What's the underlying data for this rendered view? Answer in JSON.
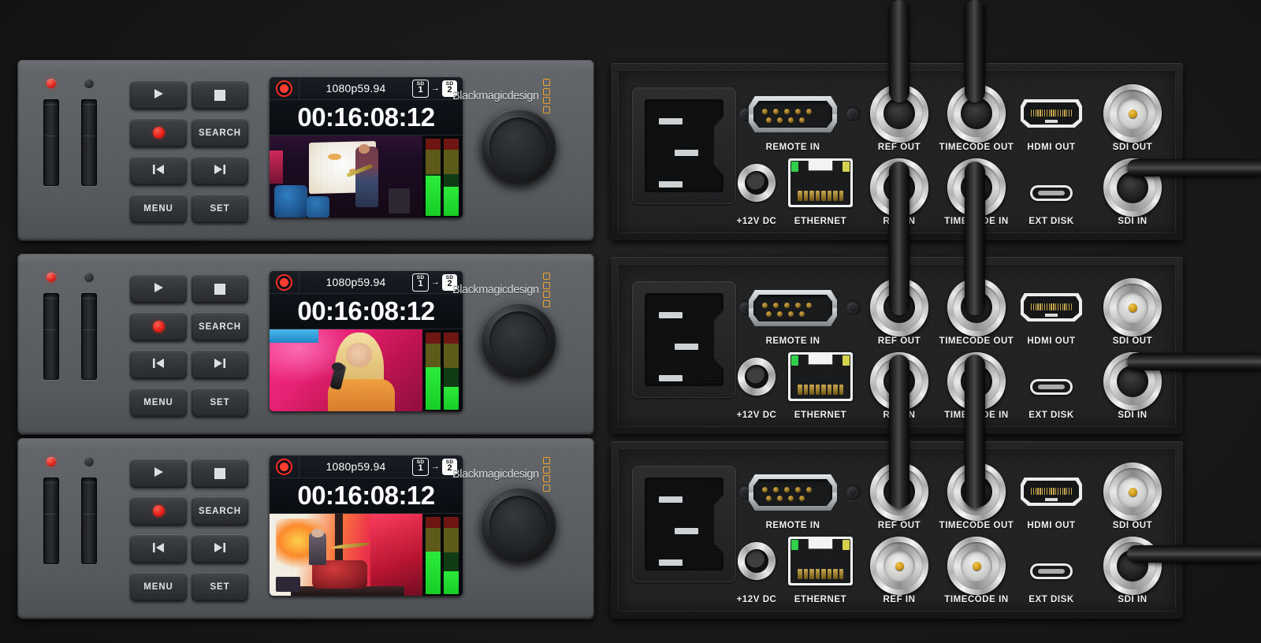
{
  "scene": {
    "description": "Three rack-mounted Blackmagic Design HyperDeck broadcast recorders, front panels left and rear panels right",
    "background_color": "#141414"
  },
  "brand": {
    "name": "Blackmagicdesign",
    "logo_color": "#f0a32a",
    "logo_square_count": 4
  },
  "front_panel": {
    "leds": [
      {
        "name": "power-led",
        "state": "on",
        "color": "#e3231d"
      },
      {
        "name": "status-led",
        "state": "off",
        "color": "#2a2c2f"
      }
    ],
    "card_slots": [
      "slot-1",
      "slot-2"
    ],
    "buttons": [
      {
        "id": "play",
        "label": "",
        "icon": "play-icon"
      },
      {
        "id": "stop",
        "label": "",
        "icon": "stop-icon"
      },
      {
        "id": "record",
        "label": "",
        "icon": "record-icon"
      },
      {
        "id": "search",
        "label": "SEARCH",
        "icon": ""
      },
      {
        "id": "prev",
        "label": "",
        "icon": "skip-previous-icon"
      },
      {
        "id": "next",
        "label": "",
        "icon": "skip-next-icon"
      },
      {
        "id": "menu",
        "label": "MENU",
        "icon": ""
      },
      {
        "id": "set",
        "label": "SET",
        "icon": ""
      }
    ],
    "jog_wheel": "jog-shuttle-wheel"
  },
  "lcd": {
    "format": "1080p59.94",
    "timecode": "00:16:08:12",
    "recording": true,
    "card_from": {
      "type": "SD",
      "number": "1",
      "style": "hollow"
    },
    "card_arrow": "→",
    "card_to": {
      "type": "SD",
      "number": "2",
      "style": "solid"
    },
    "audio_meters": 2
  },
  "units": [
    {
      "id": "unit-1",
      "lcd": {
        "format": "1080p59.94",
        "timecode": "00:16:08:12"
      },
      "thumbnail": "live-concert-guitarist-on-stage",
      "meter_levels": [
        52,
        38
      ],
      "rear": {
        "ref_out_connected": true,
        "ref_in_connected": true,
        "timecode_out_connected": true,
        "timecode_in_connected": true,
        "sdi_out_connected": false,
        "sdi_in_connected": true
      }
    },
    {
      "id": "unit-2",
      "lcd": {
        "format": "1080p59.94",
        "timecode": "00:16:08:12"
      },
      "thumbnail": "live-concert-singer-pink-lighting",
      "meter_levels": [
        55,
        30
      ],
      "rear": {
        "ref_out_connected": true,
        "ref_in_connected": true,
        "timecode_out_connected": true,
        "timecode_in_connected": true,
        "sdi_out_connected": false,
        "sdi_in_connected": true
      }
    },
    {
      "id": "unit-3",
      "lcd": {
        "format": "1080p59.94",
        "timecode": "00:16:08:12"
      },
      "thumbnail": "live-concert-drummer-red-stage",
      "meter_levels": [
        55,
        30
      ],
      "rear": {
        "ref_out_connected": true,
        "ref_in_connected": false,
        "timecode_out_connected": true,
        "timecode_in_connected": false,
        "sdi_out_connected": false,
        "sdi_in_connected": true
      }
    }
  ],
  "rear_panel": {
    "connectors": [
      {
        "id": "power-inlet",
        "label": "",
        "type": "iec-c14"
      },
      {
        "id": "remote-in",
        "label": "REMOTE IN",
        "type": "db9"
      },
      {
        "id": "dc-in",
        "label": "+12V DC",
        "type": "barrel"
      },
      {
        "id": "ethernet",
        "label": "ETHERNET",
        "type": "rj45"
      },
      {
        "id": "ref-out",
        "label": "REF OUT",
        "type": "bnc"
      },
      {
        "id": "ref-in",
        "label": "REF IN",
        "type": "bnc"
      },
      {
        "id": "timecode-out",
        "label": "TIMECODE OUT",
        "type": "bnc"
      },
      {
        "id": "timecode-in",
        "label": "TIMECODE IN",
        "type": "bnc"
      },
      {
        "id": "hdmi-out",
        "label": "HDMI OUT",
        "type": "hdmi"
      },
      {
        "id": "ext-disk",
        "label": "EXT DISK",
        "type": "usb-c"
      },
      {
        "id": "sdi-out",
        "label": "SDI OUT",
        "type": "bnc"
      },
      {
        "id": "sdi-in",
        "label": "SDI IN",
        "type": "bnc"
      }
    ]
  }
}
